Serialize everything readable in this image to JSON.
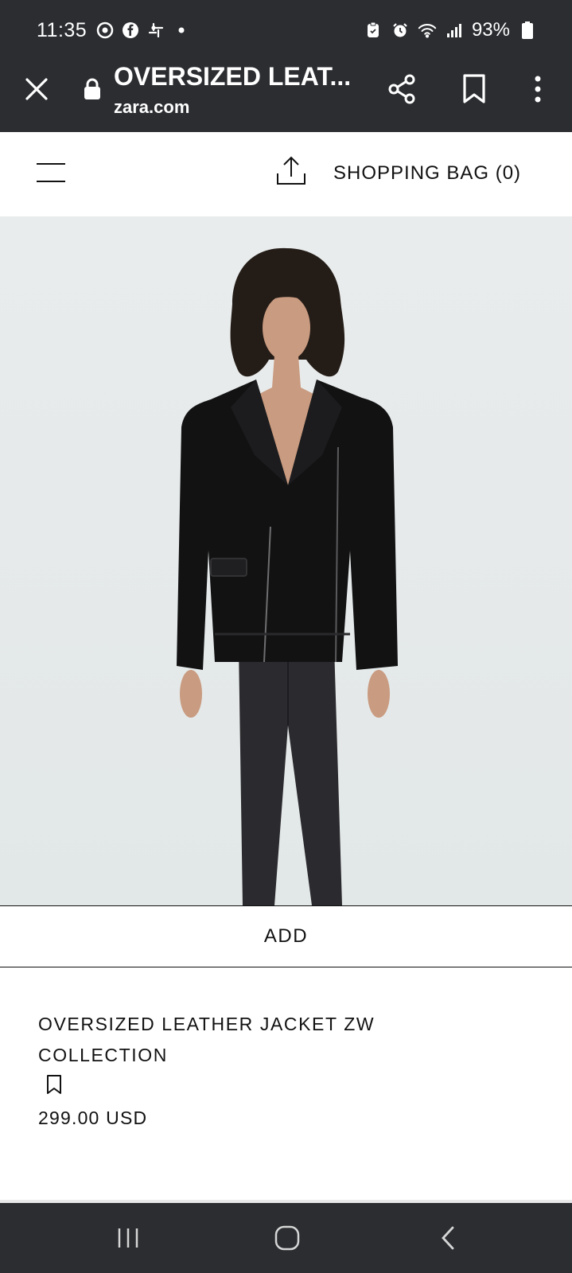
{
  "status_bar": {
    "time": "11:35",
    "battery": "93%",
    "icons": [
      "chrome-icon",
      "facebook-icon",
      "slack-icon",
      "dot-icon",
      "clipboard-icon",
      "alarm-icon",
      "wifi-icon",
      "signal-icon",
      "battery-icon"
    ]
  },
  "browser": {
    "title": "OVERSIZED LEAT...",
    "domain": "zara.com"
  },
  "header": {
    "bag_label": "SHOPPING BAG (0)"
  },
  "product": {
    "add_label": "ADD",
    "name": "OVERSIZED LEATHER JACKET ZW COLLECTION",
    "price": "299.00 USD"
  },
  "colors": {
    "system_bars": "#2b2d31",
    "image_background": "#e6eaea",
    "text": "#111111",
    "accessibility_button": "#000000"
  }
}
